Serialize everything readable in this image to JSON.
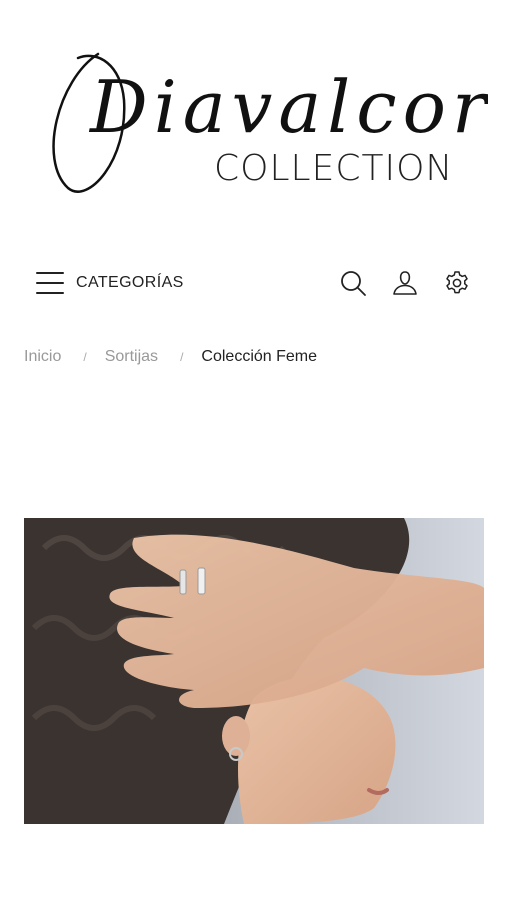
{
  "brand": {
    "script_name": "Diavalcor",
    "subtitle": "COLLECTION"
  },
  "nav": {
    "menu_label": "CATEGORÍAS",
    "icons": [
      "search-icon",
      "user-icon",
      "settings-icon"
    ]
  },
  "breadcrumb": {
    "items": [
      "Inicio",
      "Sortijas"
    ],
    "separator": "/",
    "current": "Colección Feme"
  },
  "hero": {
    "image": "model-with-rings-photo"
  },
  "colors": {
    "text": "#222222",
    "muted": "#999999",
    "background": "#ffffff"
  }
}
